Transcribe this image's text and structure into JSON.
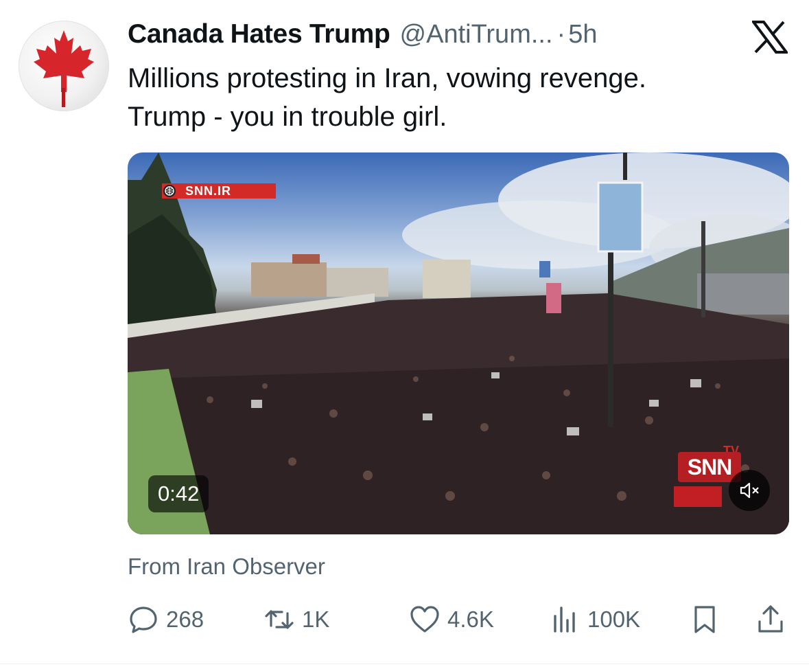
{
  "tweet": {
    "display_name": "Canada Hates Trump",
    "handle": "@AntiTrum...",
    "separator": "·",
    "time": "5h",
    "text": "Millions protesting in Iran, vowing revenge.\nTrump - you in trouble girl.",
    "avatar_icon": "maple-leaf-icon",
    "platform_icon": "x-logo-icon"
  },
  "media": {
    "type": "video",
    "watermark_text": "SNN.IR",
    "duration": "0:42",
    "channel_logo": "SNN",
    "channel_logo_sup": "TV",
    "mute_icon": "speaker-muted-icon"
  },
  "source_label": "From Iran Observer",
  "actions": {
    "replies": {
      "icon": "reply-icon",
      "count": "268"
    },
    "reposts": {
      "icon": "repost-icon",
      "count": "1K"
    },
    "likes": {
      "icon": "heart-icon",
      "count": "4.6K"
    },
    "views": {
      "icon": "views-chart-icon",
      "count": "100K"
    },
    "bookmark": {
      "icon": "bookmark-icon"
    },
    "share": {
      "icon": "share-icon"
    }
  },
  "colors": {
    "text_primary": "#0f1419",
    "text_secondary": "#536471",
    "flag_red": "#d7262b",
    "snn_red": "#d42a27"
  }
}
